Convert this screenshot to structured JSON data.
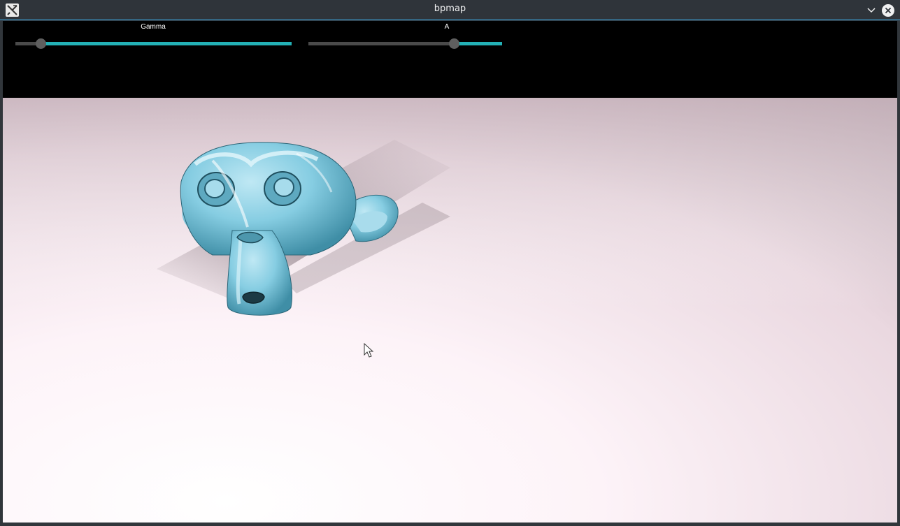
{
  "window": {
    "title": "bpmap",
    "app_icon": "x-window-icon",
    "controls": [
      "minimize-chevron-icon",
      "close-icon"
    ]
  },
  "sliders": [
    {
      "label": "Gamma",
      "value_fraction": 0.09
    },
    {
      "label": "A",
      "value_fraction": 0.75
    }
  ],
  "colors": {
    "accent": "#23b1b6",
    "titlebar": "#2f343a",
    "focus_border": "#3daee9",
    "panel": "#000000",
    "model": "#7ec8de",
    "floor": "#f5e6ee"
  }
}
